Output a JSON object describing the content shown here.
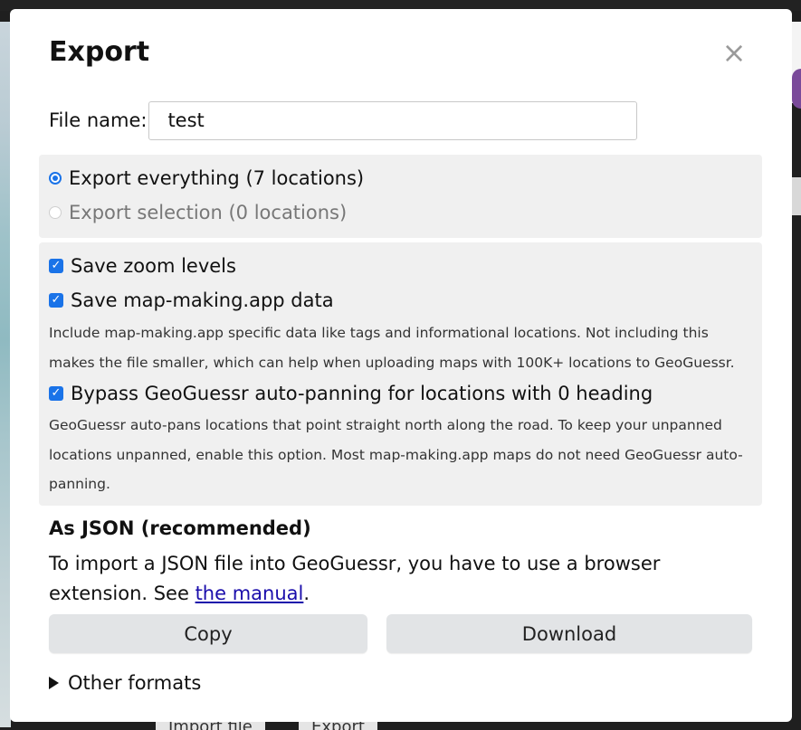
{
  "dialog": {
    "title": "Export",
    "close_glyph": "×",
    "file_name_label": "File name:",
    "file_name_value": "test"
  },
  "scope": {
    "options": [
      {
        "label": "Export everything (7 locations)",
        "checked": true,
        "disabled": false
      },
      {
        "label": "Export selection (0 locations)",
        "checked": false,
        "disabled": true
      }
    ]
  },
  "options": {
    "save_zoom": {
      "label": "Save zoom levels",
      "checked": true
    },
    "save_mm_data": {
      "label": "Save map-making.app data",
      "checked": true,
      "description": "Include map-making.app specific data like tags and informational locations. Not including this makes the file smaller, which can help when uploading maps with 100K+ locations to GeoGuessr."
    },
    "bypass_panning": {
      "label": "Bypass GeoGuessr auto-panning for locations with 0 heading",
      "checked": true,
      "description": "GeoGuessr auto-pans locations that point straight north along the road. To keep your unpanned locations unpanned, enable this option. Most map-making.app maps do not need GeoGuessr auto-panning."
    }
  },
  "json_section": {
    "title": "As JSON (recommended)",
    "info_text": "To import a JSON file into GeoGuessr, you have to use a browser extension. See ",
    "link_text": "the manual",
    "info_suffix": ".",
    "copy_label": "Copy",
    "download_label": "Download"
  },
  "other_formats": {
    "label": "Other formats"
  },
  "background": {
    "import_button": "Import file",
    "export_button": "Export"
  },
  "colors": {
    "accent": "#1a73e8",
    "link": "#1a0dab",
    "panel": "#f0f0f0",
    "button": "#e2e4e6"
  },
  "icons": {
    "close": "close-icon",
    "radio_checked": "radio-checked-icon",
    "radio_unchecked": "radio-unchecked-icon",
    "checkbox_checked": "checkbox-checked-icon",
    "disclosure": "disclosure-triangle-icon"
  }
}
